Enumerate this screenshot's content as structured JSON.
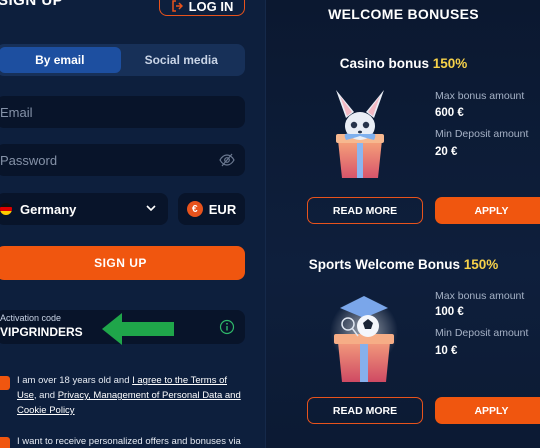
{
  "signup": {
    "title": "SIGN UP",
    "login_label": "LOG IN",
    "tabs": [
      {
        "label": "By email",
        "active": true
      },
      {
        "label": "Social media",
        "active": false
      }
    ],
    "email_placeholder": "Email",
    "password_placeholder": "Password",
    "country": "Germany",
    "currency": "EUR",
    "submit_label": "SIGN UP",
    "activation": {
      "label": "Activation code",
      "value": "VIPGRINDERS"
    },
    "terms": {
      "prefix": "I am over 18 years old and ",
      "link1": "I agree to the Terms of Use",
      "middle": ", and ",
      "link2": "Privacy, Management of Personal Data and Cookie Policy"
    },
    "offers_text": "I want to receive personalized offers and bonuses via"
  },
  "bonuses": {
    "title": "WELCOME BONUSES",
    "cards": [
      {
        "title": "Casino bonus",
        "percent": "150%",
        "max_label": "Max bonus amount",
        "max_value": "600 €",
        "min_label": "Min Deposit amount",
        "min_value": "20 €",
        "readmore_label": "READ MORE",
        "apply_label": "APPLY"
      },
      {
        "title": "Sports Welcome Bonus",
        "percent": "150%",
        "max_label": "Max bonus amount",
        "max_value": "100 €",
        "min_label": "Min Deposit amount",
        "min_value": "10 €",
        "readmore_label": "READ MORE",
        "apply_label": "APPLY"
      }
    ]
  },
  "colors": {
    "accent": "#f0560f",
    "highlight": "#f7d24a",
    "panel": "#0d1f3d",
    "input_bg": "#08142a",
    "tab_active": "#1d4fa0",
    "annotation_arrow": "#1fa64a"
  },
  "icons": [
    "login-icon",
    "eye-slash-icon",
    "germany-flag-icon",
    "chevron-down-icon",
    "euro-icon",
    "info-icon",
    "green-arrow-annotation",
    "fox-gift-illustration",
    "soccer-gift-illustration"
  ]
}
